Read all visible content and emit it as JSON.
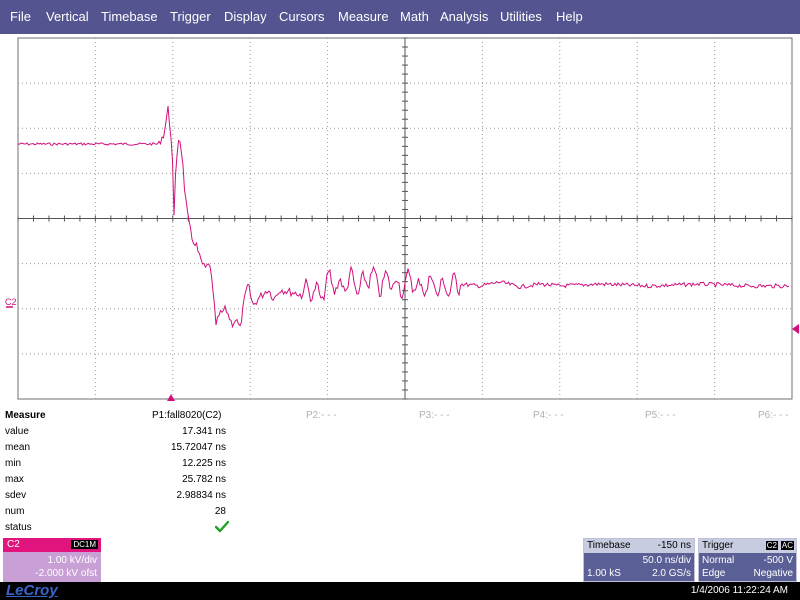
{
  "menu": [
    "File",
    "Vertical",
    "Timebase",
    "Trigger",
    "Display",
    "Cursors",
    "Measure",
    "Math",
    "Analysis",
    "Utilities",
    "Help"
  ],
  "channel_label": "C2",
  "waveform_color": "#d0107c",
  "measure": {
    "title": "Measure",
    "params": [
      "P1:fall8020(C2)",
      "P2:- - -",
      "P3:- - -",
      "P4:- - -",
      "P5:- - -",
      "P6:- - -"
    ],
    "rows": [
      {
        "label": "value",
        "value": "17.341 ns"
      },
      {
        "label": "mean",
        "value": "15.72047 ns"
      },
      {
        "label": "min",
        "value": "12.225 ns"
      },
      {
        "label": "max",
        "value": "25.782 ns"
      },
      {
        "label": "sdev",
        "value": "2.98834 ns"
      },
      {
        "label": "num",
        "value": "28"
      }
    ],
    "status_label": "status",
    "status_icon": "check-icon"
  },
  "channel_box": {
    "name": "C2",
    "coupling": "DC1M",
    "scale": "1.00 kV/div",
    "offset": "-2.000 kV ofst"
  },
  "timebase": {
    "title": "Timebase",
    "delay": "-150 ns",
    "per_div": "50.0 ns/div",
    "samples": "1.00 kS",
    "rate": "2.0 GS/s"
  },
  "trigger": {
    "title": "Trigger",
    "source": "C2",
    "coupling": "AC",
    "mode": "Normal",
    "level": "-500 V",
    "type": "Edge",
    "slope": "Negative"
  },
  "brand": "LeCroy",
  "datetime": "1/4/2006 11:22:24 AM"
}
